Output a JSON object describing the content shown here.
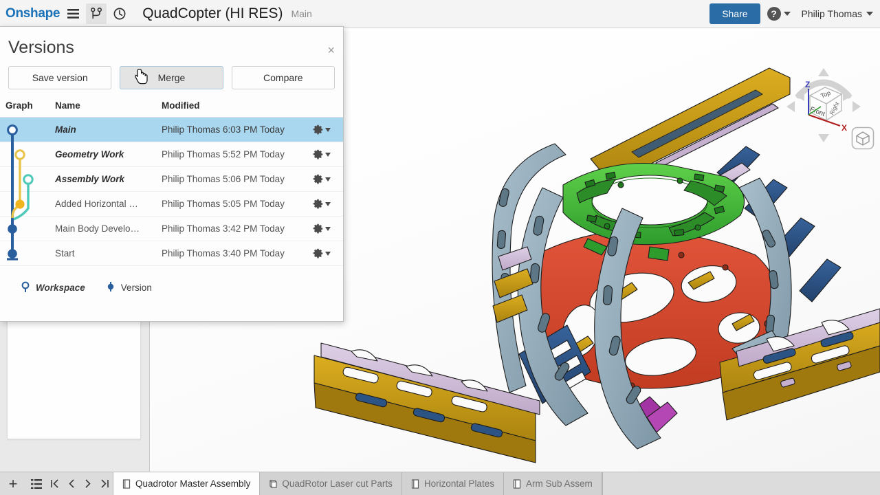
{
  "header": {
    "logo": "Onshape",
    "menu_icon": "hamburger-menu-icon",
    "branch_icon": "branch-version-icon",
    "history_icon": "clock-history-icon",
    "document_title": "QuadCopter (HI RES)",
    "workspace_name": "Main",
    "share_label": "Share",
    "help_label": "?",
    "user_name": "Philip Thomas",
    "accent_color": "#2a6da6",
    "logo_color": "#1a72b8"
  },
  "dialog": {
    "title": "Versions",
    "close_label": "×",
    "buttons": [
      {
        "label": "Save version",
        "state": "normal"
      },
      {
        "label": "Merge",
        "state": "hover"
      },
      {
        "label": "Compare",
        "state": "normal"
      }
    ],
    "columns": {
      "graph": "Graph",
      "name": "Name",
      "modified": "Modified"
    },
    "rows": [
      {
        "name": "Main",
        "modified": "Philip Thomas 6:03 PM Today",
        "kind": "workspace",
        "selected": true,
        "node_color": "#2a5f9e"
      },
      {
        "name": "Geometry Work",
        "modified": "Philip Thomas 5:52 PM Today",
        "kind": "workspace",
        "selected": false,
        "node_color": "#e8c44a"
      },
      {
        "name": "Assembly Work",
        "modified": "Philip Thomas 5:06 PM Today",
        "kind": "workspace",
        "selected": false,
        "node_color": "#4ec9b8"
      },
      {
        "name": "Added Horizontal …",
        "modified": "Philip Thomas 5:05 PM Today",
        "kind": "version",
        "selected": false,
        "node_color": "#efb51f"
      },
      {
        "name": "Main Body Develo…",
        "modified": "Philip Thomas 3:42 PM Today",
        "kind": "version",
        "selected": false,
        "node_color": "#2a5f9e"
      },
      {
        "name": "Start",
        "modified": "Philip Thomas 3:40 PM Today",
        "kind": "version",
        "selected": false,
        "node_color": "#2a5f9e"
      }
    ],
    "row_menu_icon": "gear-icon",
    "legend": [
      {
        "label": "Workspace",
        "marker": "hollow-circle"
      },
      {
        "label": "Version",
        "marker": "filled-circle"
      }
    ],
    "graph_colors": {
      "main_branch": "#2a5f9e",
      "branch_yellow": "#e8c44a",
      "branch_teal": "#4ec9b8",
      "selected_row_bg": "#a9d7ef"
    }
  },
  "viewcube": {
    "face_top": "Top",
    "face_front": "Front",
    "face_right": "Right",
    "axis_z": "Z",
    "axis_x": "X",
    "perspective_icon": "cube-view-icon"
  },
  "tabbar": {
    "add_icon": "plus-icon",
    "list_icon": "tab-list-icon",
    "nav_first_icon": "nav-first-icon",
    "nav_prev_icon": "nav-prev-icon",
    "nav_next_icon": "nav-next-icon",
    "nav_last_icon": "nav-last-icon",
    "tabs": [
      {
        "label": "Quadrotor Master Assembly",
        "icon": "assembly-tab-icon",
        "active": true
      },
      {
        "label": "QuadRotor Laser cut Parts",
        "icon": "part-studio-tab-icon",
        "active": false
      },
      {
        "label": "Horizontal Plates",
        "icon": "assembly-tab-icon",
        "active": false
      },
      {
        "label": "Arm Sub Assem",
        "icon": "assembly-tab-icon",
        "active": false
      }
    ]
  },
  "model": {
    "colors": {
      "green_plate": "#3fae38",
      "red_plate": "#d9482d",
      "gray_arc": "#8fa8b8",
      "gold_arm": "#c79a1c",
      "blue_part": "#2b5384",
      "lilac_part": "#d3bcd8",
      "magenta_part": "#a334a3"
    }
  }
}
